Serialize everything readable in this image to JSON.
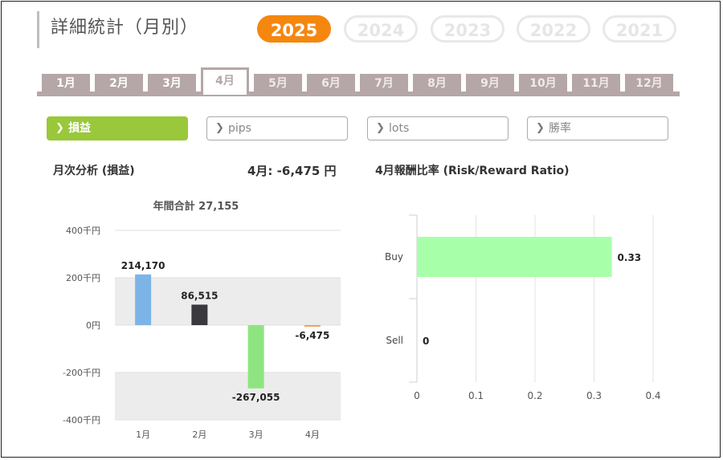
{
  "page_title": "詳細統計（月別）",
  "years": [
    {
      "label": "2025",
      "active": true
    },
    {
      "label": "2024",
      "active": false
    },
    {
      "label": "2023",
      "active": false
    },
    {
      "label": "2022",
      "active": false
    },
    {
      "label": "2021",
      "active": false
    }
  ],
  "months": [
    {
      "label": "1月",
      "state": "normal"
    },
    {
      "label": "2月",
      "state": "normal"
    },
    {
      "label": "3月",
      "state": "normal"
    },
    {
      "label": "4月",
      "state": "active"
    },
    {
      "label": "5月",
      "state": "dim"
    },
    {
      "label": "6月",
      "state": "dim"
    },
    {
      "label": "7月",
      "state": "dim"
    },
    {
      "label": "8月",
      "state": "dim"
    },
    {
      "label": "9月",
      "state": "dim"
    },
    {
      "label": "10月",
      "state": "dim"
    },
    {
      "label": "11月",
      "state": "dim"
    },
    {
      "label": "12月",
      "state": "dim"
    }
  ],
  "filters": [
    {
      "label": "損益",
      "active": true
    },
    {
      "label": "pips",
      "active": false
    },
    {
      "label": "lots",
      "active": false
    },
    {
      "label": "勝率",
      "active": false
    }
  ],
  "colors": {
    "accent": "#f5870f",
    "tab": "#b5a7a7",
    "filter_active": "#99c83a"
  },
  "monthly": {
    "heading": "月次分析 (損益)",
    "month_summary": "4月:  -6,475 円"
  },
  "rr": {
    "heading": "4月報酬比率 (Risk/Reward Ratio)"
  },
  "chart_data": [
    {
      "type": "bar",
      "title": "年間合計 27,155",
      "categories": [
        "1月",
        "2月",
        "3月",
        "4月"
      ],
      "values": [
        214170,
        86515,
        -267055,
        -6475
      ],
      "value_labels": [
        "214,170",
        "86,515",
        "-267,055",
        "-6,475"
      ],
      "bar_colors": [
        "#7db4e8",
        "#3a3a3e",
        "#8ee57f",
        "#f0a050"
      ],
      "y_ticks": [
        400000,
        200000,
        0,
        -200000,
        -400000
      ],
      "y_tick_labels": [
        "400千円",
        "200千円",
        "0円",
        "-200千円",
        "-400千円"
      ],
      "ylim": [
        -400000,
        400000
      ],
      "grid": true
    },
    {
      "type": "bar",
      "orientation": "horizontal",
      "categories": [
        "Buy",
        "Sell"
      ],
      "values": [
        0.33,
        0
      ],
      "value_labels": [
        "0.33",
        "0"
      ],
      "bar_color": "#a8ffaa",
      "x_ticks": [
        0,
        0.1,
        0.2,
        0.3,
        0.4
      ],
      "x_tick_labels": [
        "0",
        "0.1",
        "0.2",
        "0.3",
        "0.4"
      ],
      "xlim": [
        0,
        0.4
      ],
      "grid": true
    }
  ]
}
